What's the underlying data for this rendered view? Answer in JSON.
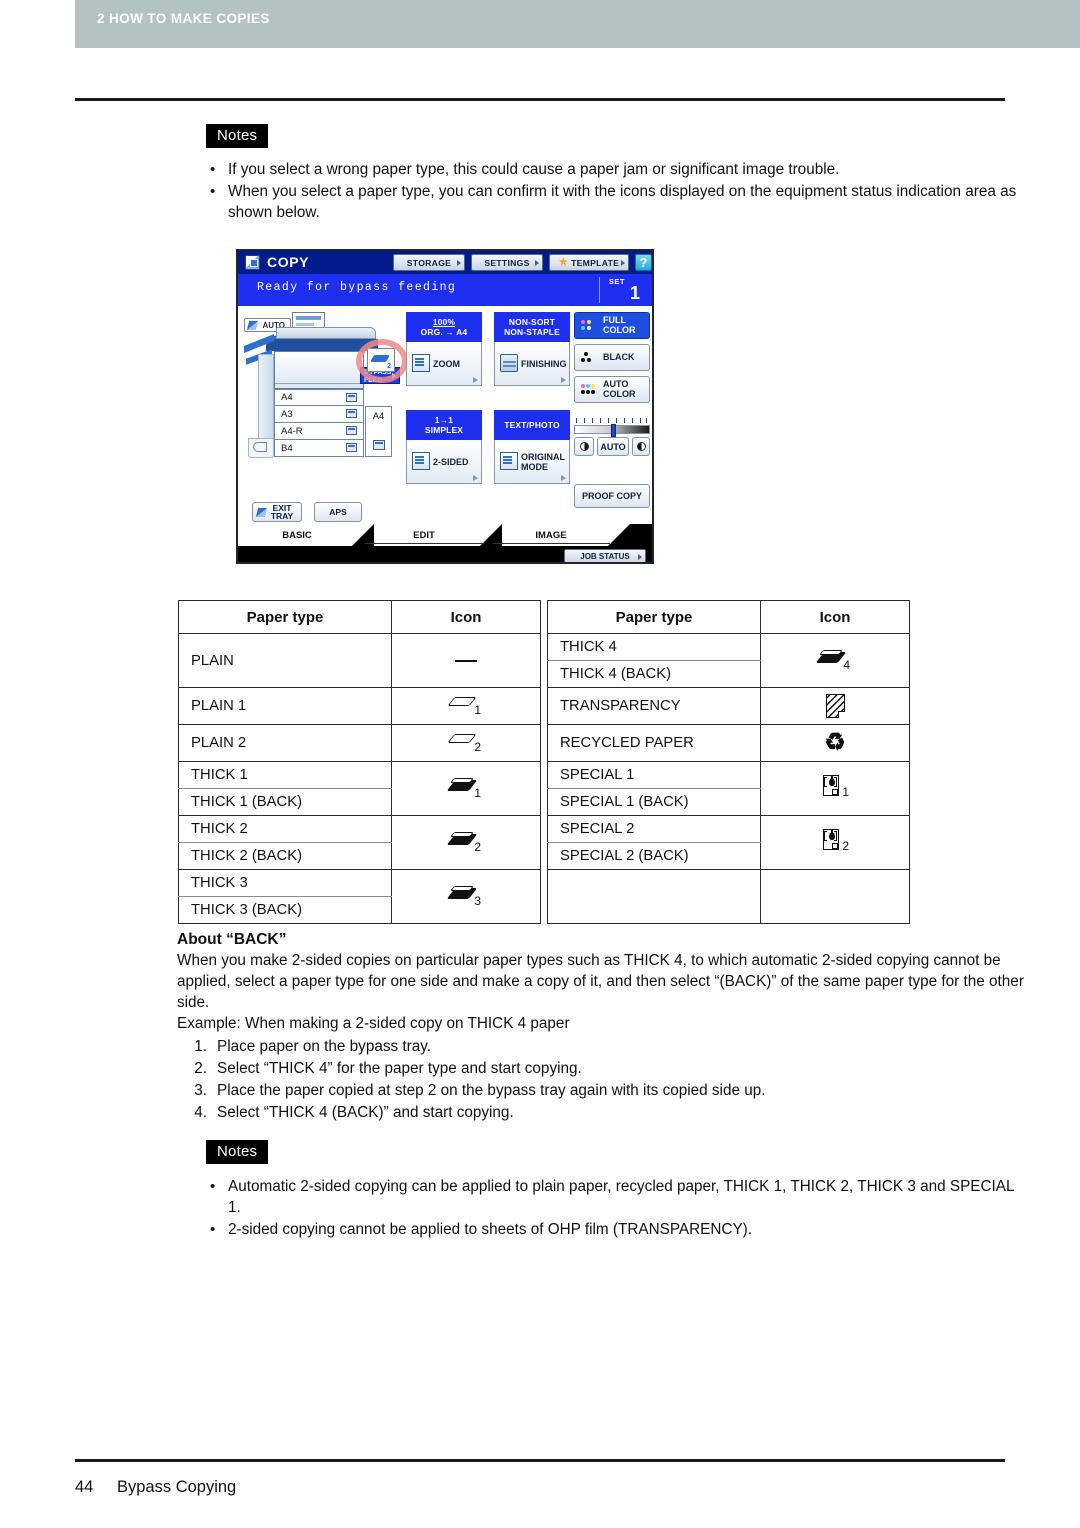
{
  "header": {
    "chapter": "2 HOW TO MAKE COPIES"
  },
  "notes_top": {
    "tag": "Notes",
    "bullet_char": "•",
    "items": [
      "If you select a wrong paper type, this could cause a paper jam or significant image trouble.",
      "When you select a paper type, you can confirm it with the icons displayed on the equipment status indication area as shown below."
    ]
  },
  "lcd": {
    "app_title": "COPY",
    "toolbar": {
      "storage": "STORAGE",
      "settings": "SETTINGS",
      "template": "TEMPLATE",
      "help": "?"
    },
    "status_message": "Ready for bypass feeding",
    "set_label": "SET",
    "set_value": "1",
    "auto_badge": "AUTO",
    "drawers": [
      "A4",
      "A3",
      "A4-R",
      "B4"
    ],
    "bypass_label": "A4",
    "bypass_feed": "BYPASS FEED",
    "bypass_icon_number": "2",
    "exit_tray": "EXIT TRAY",
    "aps": "APS",
    "functions": [
      {
        "cap_line1": "100%",
        "cap_line2": "ORG. → A4",
        "label": "ZOOM"
      },
      {
        "cap_line1": "NON-SORT",
        "cap_line2": "NON-STAPLE",
        "label": "FINISHING"
      },
      {
        "cap_line1": "1→1",
        "cap_line2": "SIMPLEX",
        "label": "2-SIDED"
      },
      {
        "cap_line1": "TEXT/PHOTO",
        "cap_line2": "",
        "label": "ORIGINAL MODE"
      }
    ],
    "color_modes": [
      {
        "line1": "FULL",
        "line2": "COLOR"
      },
      {
        "line1": "BLACK",
        "line2": ""
      },
      {
        "line1": "AUTO",
        "line2": "COLOR"
      }
    ],
    "density_auto": "AUTO",
    "proof_copy": "PROOF COPY",
    "tabs": [
      "BASIC",
      "EDIT",
      "IMAGE"
    ],
    "job_status": "JOB STATUS",
    "accent_tab_color": "#f08c00",
    "panel_blue": "#1f2ff0",
    "titlebar_blue": "#001c8c",
    "highlight_ring_color": "#f08a8a"
  },
  "table": {
    "headers": [
      "Paper type",
      "Icon",
      "Paper type",
      "Icon"
    ],
    "left_rows": [
      {
        "types": [
          "PLAIN"
        ],
        "icon": "dash",
        "icon_number": ""
      },
      {
        "types": [
          "PLAIN 1"
        ],
        "icon": "plain-sheet",
        "icon_number": "1"
      },
      {
        "types": [
          "PLAIN 2"
        ],
        "icon": "plain-sheet",
        "icon_number": "2"
      },
      {
        "types": [
          "THICK 1",
          "THICK 1 (BACK)"
        ],
        "icon": "thick-sheet",
        "icon_number": "1"
      },
      {
        "types": [
          "THICK 2",
          "THICK 2 (BACK)"
        ],
        "icon": "thick-sheet",
        "icon_number": "2"
      },
      {
        "types": [
          "THICK 3",
          "THICK 3 (BACK)"
        ],
        "icon": "thick-sheet",
        "icon_number": "3"
      }
    ],
    "right_rows": [
      {
        "types": [
          "THICK 4",
          "THICK 4 (BACK)"
        ],
        "icon": "thick-sheet",
        "icon_number": "4"
      },
      {
        "types": [
          "TRANSPARENCY"
        ],
        "icon": "transparency-sheet",
        "icon_number": ""
      },
      {
        "types": [
          "RECYCLED PAPER"
        ],
        "icon": "recycle",
        "icon_number": ""
      },
      {
        "types": [
          "SPECIAL 1",
          "SPECIAL 1 (BACK)"
        ],
        "icon": "special-page",
        "icon_number": "1"
      },
      {
        "types": [
          "SPECIAL 2",
          "SPECIAL 2 (BACK)"
        ],
        "icon": "special-page",
        "icon_number": "2"
      },
      {
        "types": [],
        "icon": "none",
        "icon_number": ""
      }
    ],
    "recycle_glyph": "♻"
  },
  "about_back": {
    "heading": "About “BACK”",
    "paragraph": "When you make 2-sided copies on particular paper types such as THICK 4, to which automatic 2-sided copying cannot be applied, select a paper type for one side and make a copy of it, and then select “(BACK)” of the same paper type for the other side.",
    "example": "Example: When making a 2-sided copy on THICK 4 paper",
    "steps": [
      "Place paper on the bypass tray.",
      "Select “THICK 4” for the paper type and start copying.",
      "Place the paper copied at step 2 on the bypass tray again with its copied side up.",
      "Select “THICK 4 (BACK)” and start copying."
    ],
    "step_numbers": [
      "1.",
      "2.",
      "3.",
      "4."
    ]
  },
  "notes_bottom": {
    "tag": "Notes",
    "bullet_char": "•",
    "items": [
      "Automatic 2-sided copying can be applied to plain paper, recycled paper, THICK 1, THICK 2, THICK 3 and SPECIAL 1.",
      "2-sided copying cannot be applied to sheets of OHP film (TRANSPARENCY)."
    ]
  },
  "footer": {
    "page_number": "44",
    "section": "Bypass Copying"
  }
}
